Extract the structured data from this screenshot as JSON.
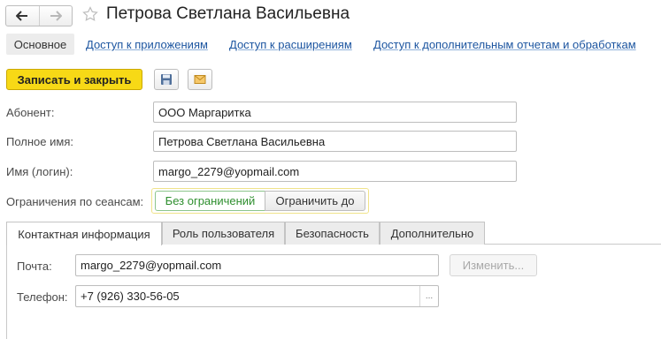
{
  "window": {
    "title": "Петрова Светлана Васильевна"
  },
  "sections": {
    "active": "Основное",
    "links": [
      "Доступ к приложениям",
      "Доступ к расширениям",
      "Доступ к дополнительным отчетам и обработкам"
    ]
  },
  "toolbar": {
    "save_close_label": "Записать и закрыть"
  },
  "form": {
    "subscriber_label": "Абонент:",
    "subscriber_value": "ООО Маргаритка",
    "full_name_label": "Полное имя:",
    "full_name_value": "Петрова Светлана Васильевна",
    "login_label": "Имя (логин):",
    "login_value": "margo_2279@yopmail.com",
    "sessions_label": "Ограничения по сеансам:",
    "sessions_options": [
      "Без ограничений",
      "Ограничить до"
    ],
    "sessions_selected": "Без ограничений"
  },
  "tabs": [
    "Контактная информация",
    "Роль пользователя",
    "Безопасность",
    "Дополнительно"
  ],
  "contact": {
    "email_label": "Почта:",
    "email_value": "margo_2279@yopmail.com",
    "change_button": "Изменить...",
    "phone_label": "Телефон:",
    "phone_value": "+7 (926) 330-56-05",
    "phone_more": "..."
  },
  "colors": {
    "primary_button": "#f7d916",
    "link": "#1c55a0",
    "selected_option": "#2f8f2f"
  },
  "icons": {
    "back": "arrow-left-icon",
    "forward": "arrow-right-icon",
    "favorite": "star-icon",
    "save": "floppy-disk-icon",
    "mail": "envelope-icon"
  }
}
